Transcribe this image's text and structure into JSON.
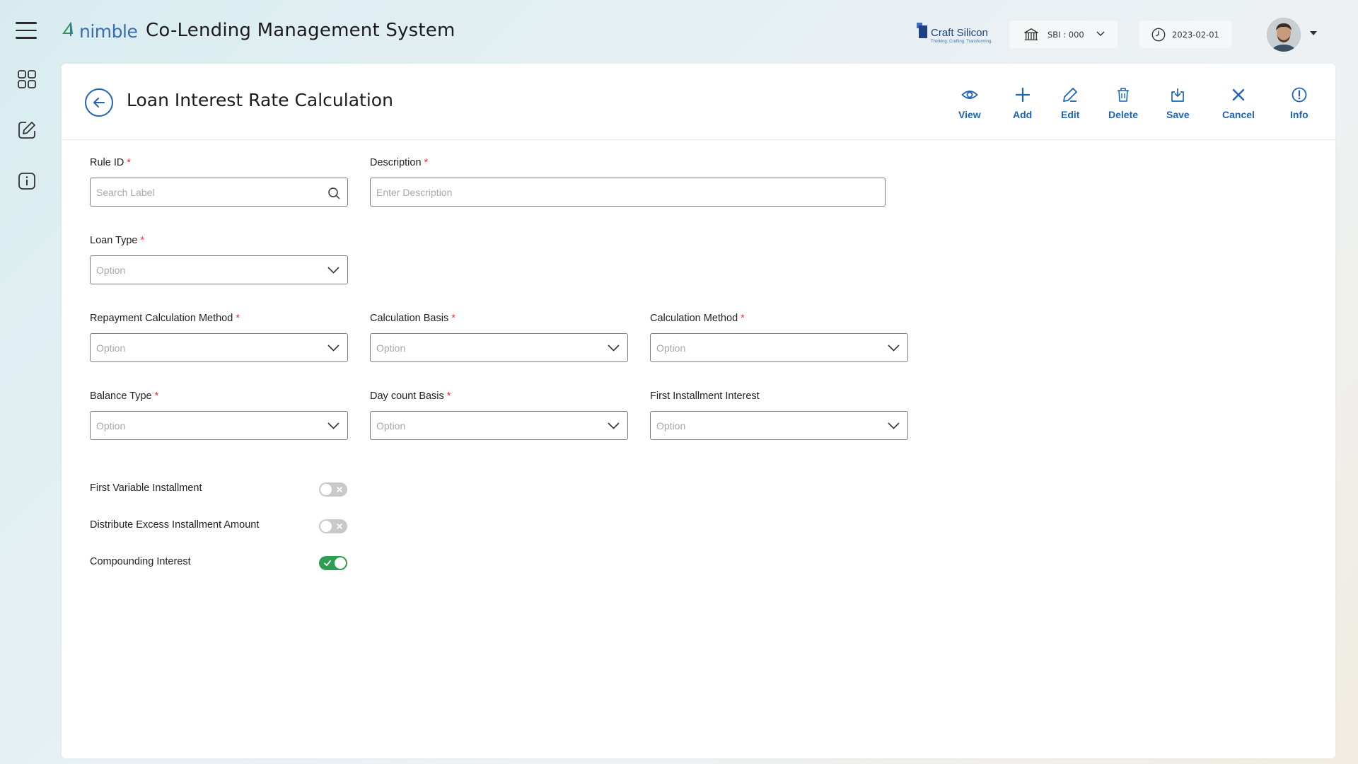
{
  "app": {
    "brand": "nimble",
    "title": "Co-Lending Management System"
  },
  "partner": {
    "name": "Craft Silicon",
    "tagline": "Thinking. Crafting. Transforming."
  },
  "header": {
    "bank_label": "SBI : 000",
    "date": "2023-02-01"
  },
  "page": {
    "title": "Loan Interest Rate Calculation"
  },
  "toolbar": {
    "view": "View",
    "add": "Add",
    "edit": "Edit",
    "delete": "Delete",
    "save": "Save",
    "cancel": "Cancel",
    "info": "Info"
  },
  "form": {
    "rule_id": {
      "label": "Rule ID",
      "placeholder": "Search Label",
      "required": "*"
    },
    "description": {
      "label": "Description",
      "placeholder": "Enter Description",
      "required": "*"
    },
    "loan_type": {
      "label": "Loan Type",
      "placeholder": "Option",
      "required": "*"
    },
    "repayment_method": {
      "label": "Repayment Calculation Method",
      "placeholder": "Option",
      "required": "*"
    },
    "calc_basis": {
      "label": "Calculation Basis",
      "placeholder": "Option",
      "required": "*"
    },
    "calc_method": {
      "label": "Calculation Method",
      "placeholder": "Option",
      "required": "*"
    },
    "balance_type": {
      "label": "Balance Type",
      "placeholder": "Option",
      "required": "*"
    },
    "day_count": {
      "label": "Day count Basis",
      "placeholder": "Option",
      "required": "*"
    },
    "first_installment_interest": {
      "label": "First Installment Interest",
      "placeholder": "Option"
    }
  },
  "toggles": {
    "first_variable": {
      "label": "First Variable  Installment",
      "on": false
    },
    "distribute_excess": {
      "label": "Distribute Excess Installment Amount",
      "on": false
    },
    "compounding": {
      "label": "Compounding Interest",
      "on": true
    }
  },
  "colors": {
    "accent": "#1f63b4",
    "required": "#e53935",
    "toggle_on": "#2e9e52",
    "toggle_off": "#c9c9c9"
  },
  "icons": {
    "rail": [
      "grid-icon",
      "edit-square-icon",
      "info-square-icon"
    ]
  }
}
